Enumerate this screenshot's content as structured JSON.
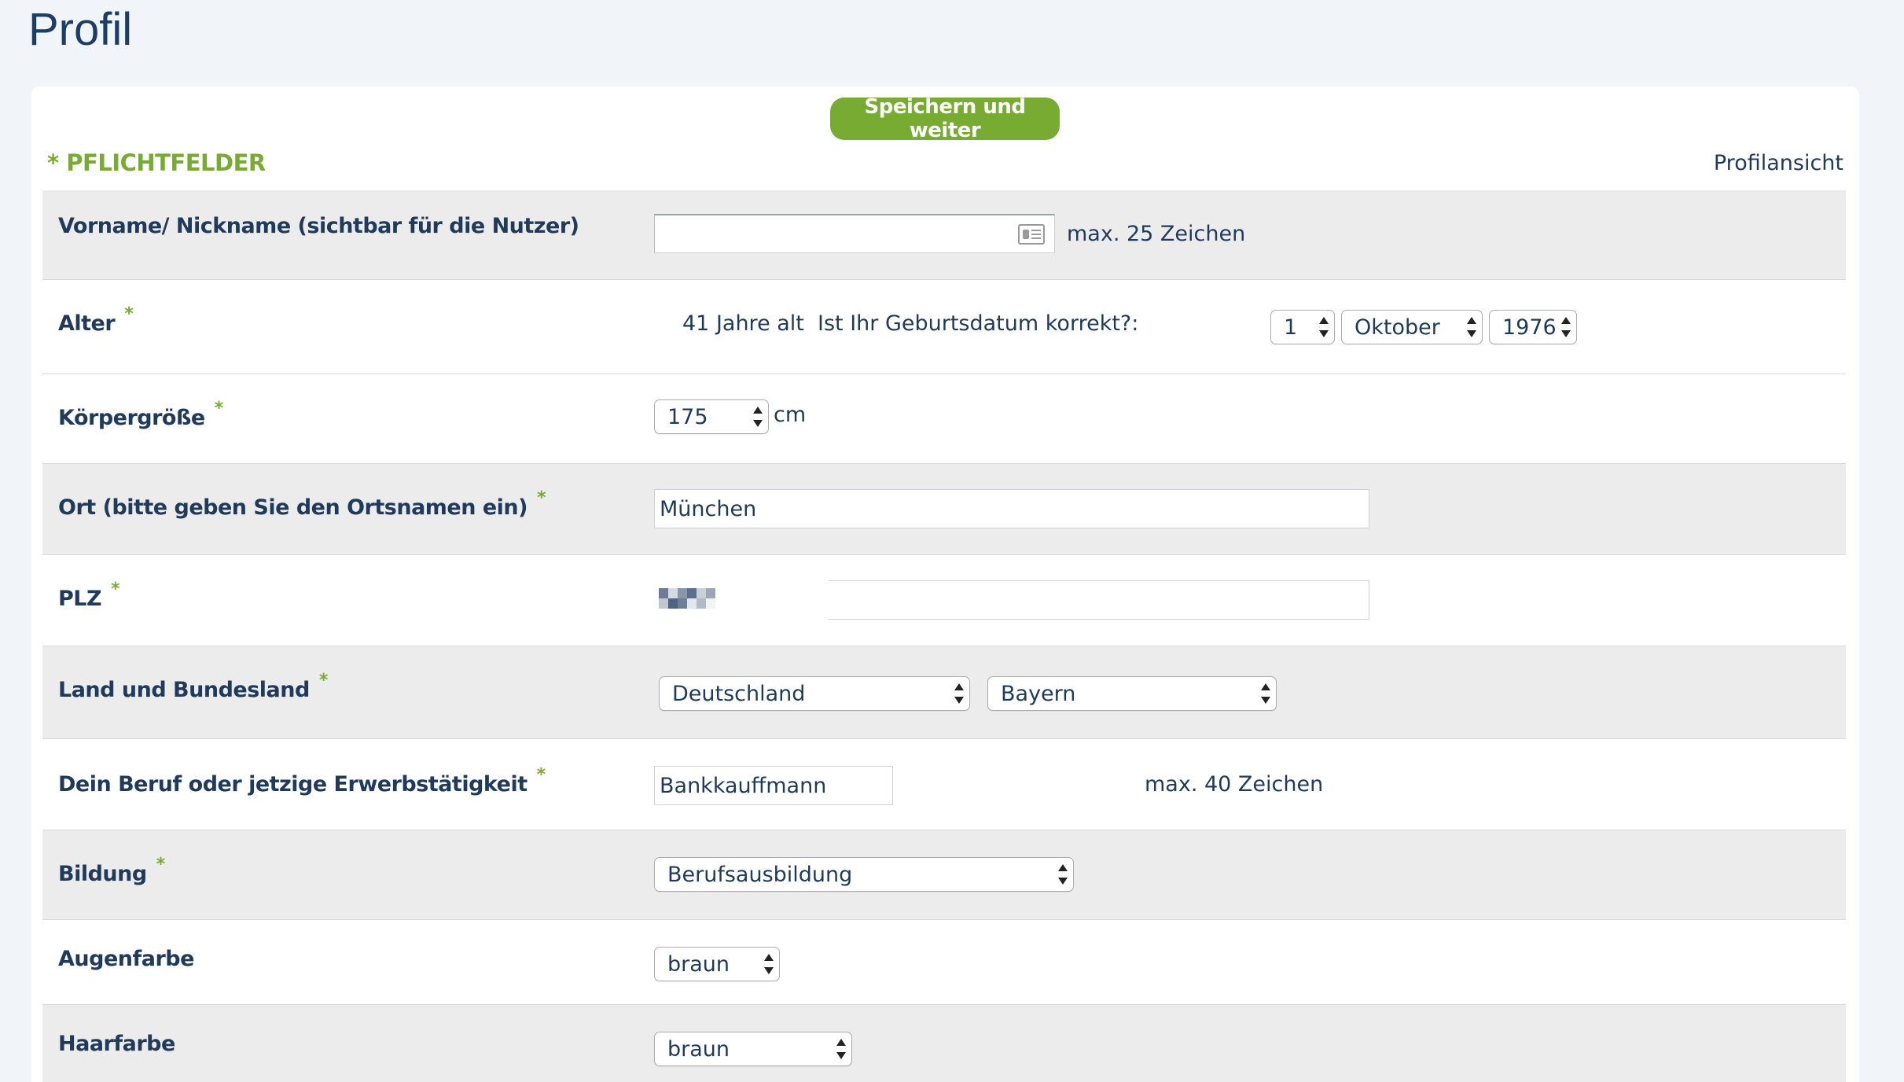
{
  "page": {
    "title": "Profil"
  },
  "toolbar": {
    "save_label": "Speichern und weiter"
  },
  "legend": {
    "required_label": "* PFLICHTFELDER",
    "profile_view_link": "Profilansicht"
  },
  "fields": {
    "nickname": {
      "label": "Vorname/ Nickname (sichtbar für die Nutzer)",
      "value": "",
      "hint": "max. 25 Zeichen",
      "icon": "contact-card-icon"
    },
    "age": {
      "label": "Alter",
      "required": "*",
      "age_text": "41 Jahre alt",
      "question": "Ist Ihr Geburtsdatum korrekt?:",
      "day": "1",
      "month": "Oktober",
      "year": "1976"
    },
    "height": {
      "label": "Körpergröße",
      "required": "*",
      "value": "175",
      "unit": "cm"
    },
    "city": {
      "label": "Ort (bitte geben Sie den Ortsnamen ein)",
      "required": "*",
      "value": "München"
    },
    "zip": {
      "label": "PLZ",
      "required": "*"
    },
    "country_state": {
      "label": "Land und Bundesland",
      "required": "*",
      "country": "Deutschland",
      "state": "Bayern"
    },
    "occupation": {
      "label": "Dein Beruf oder jetzige Erwerbstätigkeit",
      "required": "*",
      "value": "Bankkauffmann",
      "hint": "max. 40 Zeichen"
    },
    "education": {
      "label": "Bildung",
      "required": "*",
      "value": "Berufsausbildung"
    },
    "eye_color": {
      "label": "Augenfarbe",
      "value": "braun"
    },
    "hair_color": {
      "label": "Haarfarbe",
      "value": "braun"
    }
  },
  "colors": {
    "accent_green": "#77ab32",
    "text_navy": "#1f3a5a",
    "title_blue": "#1b3d66",
    "row_shade": "#ececec",
    "background": "#f1f4f8"
  }
}
